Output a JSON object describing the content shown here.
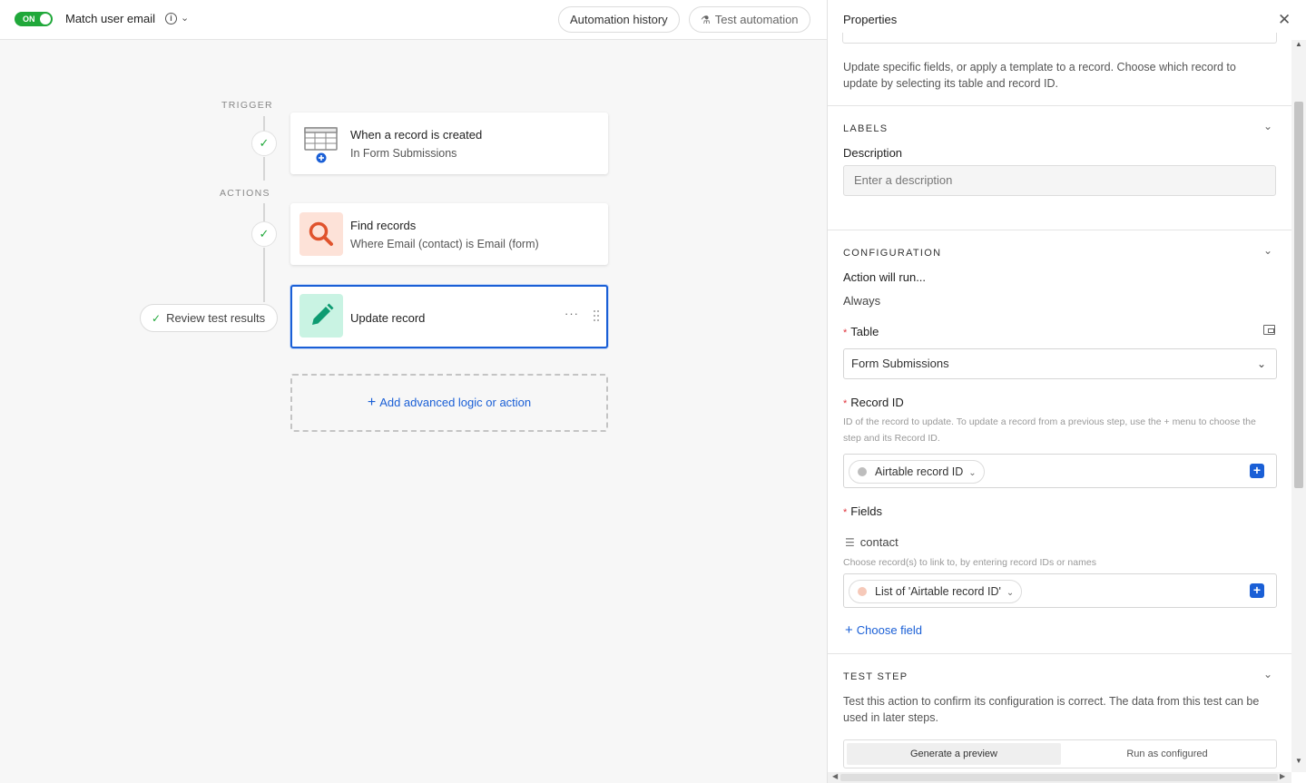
{
  "topbar": {
    "toggle_label": "ON",
    "automation_name": "Match user email",
    "info_glyph": "i",
    "history_label": "Automation history",
    "test_label": "Test automation"
  },
  "canvas": {
    "trigger_label": "TRIGGER",
    "actions_label": "ACTIONS",
    "steps": [
      {
        "title": "When a record is created",
        "subtitle": "In Form Submissions",
        "icon": "table-plus-icon"
      },
      {
        "title": "Find records",
        "subtitle": "Where Email (contact) is Email (form)",
        "icon": "search-icon",
        "icon_bg": "#fde2d8",
        "icon_color": "#e0532d"
      },
      {
        "title": "Update record",
        "subtitle": "",
        "icon": "pencil-icon",
        "icon_bg": "#c9f3e3",
        "icon_color": "#0e9b72",
        "selected": true
      }
    ],
    "review_label": "Review test results",
    "add_label": "Add advanced logic or action"
  },
  "panel": {
    "title": "Properties",
    "intro": "Update specific fields, or apply a template to a record. Choose which record to update by selecting its table and record ID.",
    "labels_section": "LABELS",
    "description_label": "Description",
    "description_placeholder": "Enter a description",
    "configuration_section": "CONFIGURATION",
    "action_run_label": "Action will run...",
    "action_run_value": "Always",
    "table_label": "Table",
    "table_value": "Form Submissions",
    "record_id_label": "Record ID",
    "record_id_hint": "ID of the record to update. To update a record from a previous step, use the + menu to choose the step and its Record ID.",
    "record_id_token": "Airtable record ID",
    "fields_label": "Fields",
    "field_name": "contact",
    "field_hint": "Choose record(s) to link to, by entering record IDs or names",
    "field_token": "List of 'Airtable record ID'",
    "choose_field_label": "Choose field",
    "test_section": "TEST STEP",
    "test_desc": "Test this action to confirm its configuration is correct. The data from this test can be used in later steps.",
    "generate_label": "Generate a preview",
    "run_label": "Run as configured"
  },
  "colors": {
    "accent": "#1a5fd6",
    "on_green": "#20a83a",
    "required": "#e0343d"
  }
}
